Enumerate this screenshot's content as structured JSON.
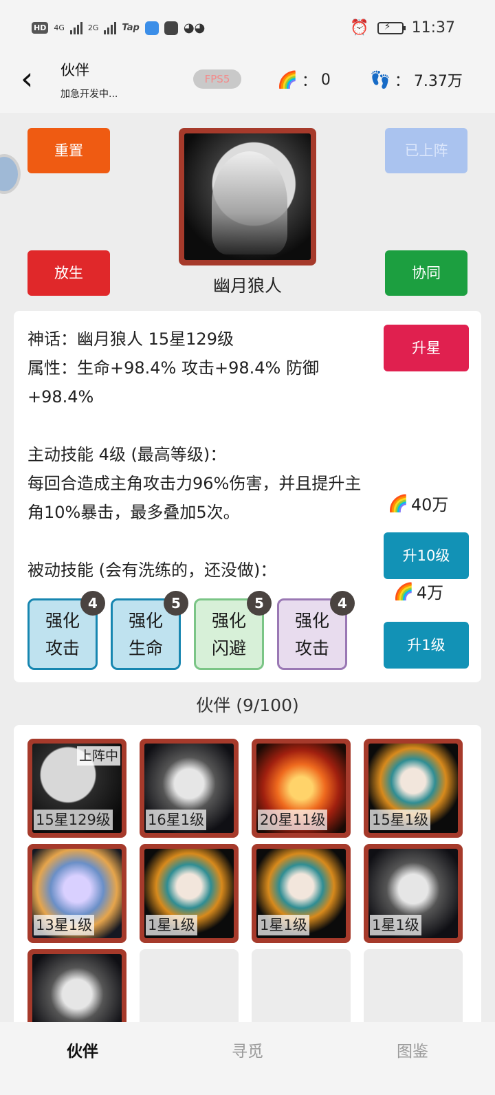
{
  "statusbar": {
    "network_hd": "HD",
    "net1": "4G",
    "net2": "2G",
    "tap_app": "Tap",
    "time": "11:37"
  },
  "header": {
    "back_icon": "chevron-left-icon",
    "title": "伙伴",
    "subtitle": "加急开发中...",
    "fps": "FPS5",
    "rainbow_value": "0",
    "steps_value": "7.37万",
    "stat_sep": "："
  },
  "hero": {
    "reset_label": "重置",
    "release_label": "放生",
    "onstage_label": "已上阵",
    "coop_label": "协同",
    "name": "幽月狼人"
  },
  "detail": {
    "line1": "神话：幽月狼人  15星129级",
    "line2": "属性：生命+98.4% 攻击+98.4% 防御+98.4%",
    "line3": "主动技能 4级 (最高等级)：",
    "line4": "每回合造成主角攻击力96%伤害，并且提升主角10%暴击，最多叠加5次。",
    "line5": "被动技能 (会有洗练的，还没做)：",
    "star_label": "升星",
    "cost10": "40万",
    "up10_label": "升10级",
    "cost1": "4万",
    "up1_label": "升1级",
    "passives": [
      {
        "l1": "强化",
        "l2": "攻击",
        "level": "4",
        "color": "blue"
      },
      {
        "l1": "强化",
        "l2": "生命",
        "level": "5",
        "color": "blue"
      },
      {
        "l1": "强化",
        "l2": "闪避",
        "level": "5",
        "color": "green"
      },
      {
        "l1": "强化",
        "l2": "攻击",
        "level": "4",
        "color": "purple"
      }
    ]
  },
  "roster": {
    "title": "伙伴 (9/100)",
    "items": [
      {
        "label": "15星129级",
        "tag": "上阵中"
      },
      {
        "label": "16星1级"
      },
      {
        "label": "20星11级"
      },
      {
        "label": "15星1级"
      },
      {
        "label": "13星1级"
      },
      {
        "label": "1星1级"
      },
      {
        "label": "1星1级"
      },
      {
        "label": "1星1级"
      },
      {
        "label": ""
      }
    ]
  },
  "tabs": [
    "伙伴",
    "寻觅",
    "图鉴"
  ]
}
